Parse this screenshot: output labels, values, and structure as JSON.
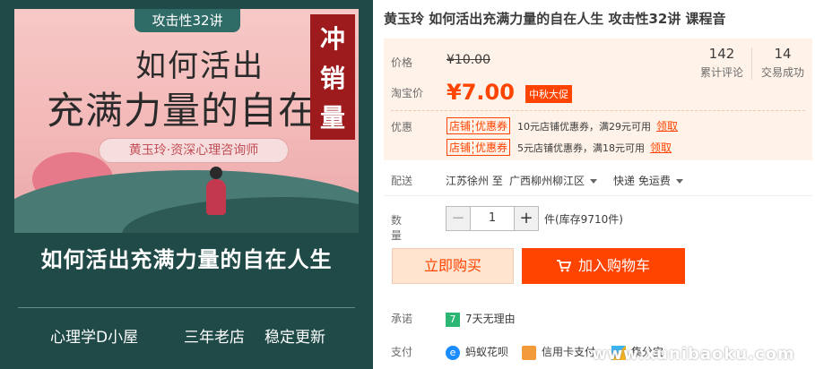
{
  "product_image": {
    "tag": "攻击性32讲",
    "headline1": "如何活出",
    "headline2": "充满力量的自在人",
    "ribbon": "冲销量",
    "subtitle": "黄玉玲·资深心理咨询师",
    "main_title": "如何活出充满力量的自在人生",
    "footer": [
      "心理学D小屋",
      "三年老店",
      "稳定更新"
    ]
  },
  "product": {
    "title": "黄玉玲 如何活出充满力量的自在人生 攻击性32讲 课程音",
    "price_label": "价格",
    "original_price": "¥10.00",
    "taobao_label": "淘宝价",
    "price": "¥7.00",
    "promo_badge": "中秋大促",
    "stats": [
      {
        "value": "142",
        "label": "累计评论"
      },
      {
        "value": "14",
        "label": "交易成功"
      }
    ],
    "coupon_label": "优惠",
    "coupons": [
      {
        "tag": "店铺",
        "type": "优惠券",
        "text": "10元店铺优惠券，满29元可用",
        "link": "领取"
      },
      {
        "tag": "店铺",
        "type": "优惠券",
        "text": "5元店铺优惠券，满18元可用",
        "link": "领取"
      }
    ],
    "shipping_label": "配送",
    "ship_from": "江苏徐州 至",
    "ship_to": "广西柳州柳江区",
    "ship_method": "快递 免运费",
    "quantity_label": "数量",
    "quantity": "1",
    "stock": "件(库存9710件)",
    "buy_now": "立即购买",
    "add_cart": "加入购物车",
    "promise_label": "承诺",
    "promise_text": "7天无理由",
    "payment_label": "支付",
    "payments": [
      "蚂蚁花呗",
      "信用卡支付",
      "集分宝"
    ],
    "watermark": "www.xunibaoku.com"
  },
  "colors": {
    "accent": "#ff4400",
    "image_bg": "#1f4a47",
    "price_bg": "#fff2e8"
  }
}
